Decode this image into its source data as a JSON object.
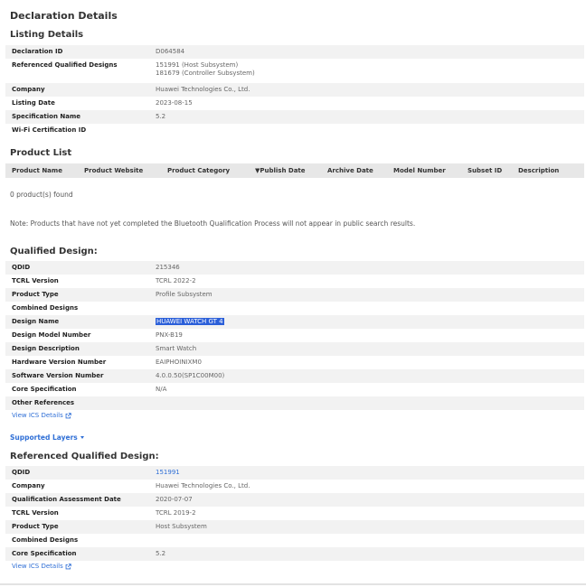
{
  "page_title": "Declaration Details",
  "listing": {
    "heading": "Listing Details",
    "rows": [
      {
        "key": "Declaration ID",
        "value": "D064584"
      },
      {
        "key": "Referenced Qualified Designs",
        "value": "151991 (Host Subsystem)",
        "value2": "181679 (Controller Subsystem)"
      },
      {
        "key": "Company",
        "value": "Huawei Technologies Co., Ltd."
      },
      {
        "key": "Listing Date",
        "value": "2023-08-15"
      },
      {
        "key": "Specification Name",
        "value": "5.2"
      },
      {
        "key": "Wi-Fi Certification ID",
        "value": ""
      }
    ]
  },
  "product_list": {
    "heading": "Product List",
    "columns": [
      "Product Name",
      "Product Website",
      "Product Category",
      "▼Publish Date",
      "Archive Date",
      "Model Number",
      "Subset ID",
      "Description"
    ],
    "count_text": "0 product(s) found",
    "note": "Note: Products that have not yet completed the Bluetooth Qualification Process will not appear in public search results."
  },
  "qualified_design": {
    "heading": "Qualified Design:",
    "rows": [
      {
        "key": "QDID",
        "value": "215346"
      },
      {
        "key": "TCRL Version",
        "value": "TCRL 2022-2"
      },
      {
        "key": "Product Type",
        "value": "Profile Subsystem"
      },
      {
        "key": "Combined Designs",
        "value": ""
      },
      {
        "key": "Design Name",
        "value": "HUAWEI WATCH GT 4"
      },
      {
        "key": "Design Model Number",
        "value": "PNX-B19"
      },
      {
        "key": "Design Description",
        "value": "Smart Watch"
      },
      {
        "key": "Hardware Version Number",
        "value": "EAIPHOINIXM0"
      },
      {
        "key": "Software Version Number",
        "value": "4.0.0.50(SP1C00M00)"
      },
      {
        "key": "Core Specification",
        "value": "N/A"
      },
      {
        "key": "Other References",
        "value": ""
      }
    ],
    "ics_link": "View ICS Details"
  },
  "supported_layers": "Supported Layers",
  "referenced_design": {
    "heading": "Referenced Qualified Design:",
    "rows": [
      {
        "key": "QDID",
        "value": "151991"
      },
      {
        "key": "Company",
        "value": "Huawei Technologies Co., Ltd."
      },
      {
        "key": "Qualification Assessment Date",
        "value": "2020-07-07"
      },
      {
        "key": "TCRL Version",
        "value": "TCRL 2019-2"
      },
      {
        "key": "Product Type",
        "value": "Host Subsystem"
      },
      {
        "key": "Combined Designs",
        "value": ""
      },
      {
        "key": "Core Specification",
        "value": "5.2"
      }
    ],
    "ics_link": "View ICS Details"
  },
  "colors": {
    "link": "#2f6fd6",
    "highlight": "#2b5fd9",
    "stripe": "#f2f2f2"
  }
}
